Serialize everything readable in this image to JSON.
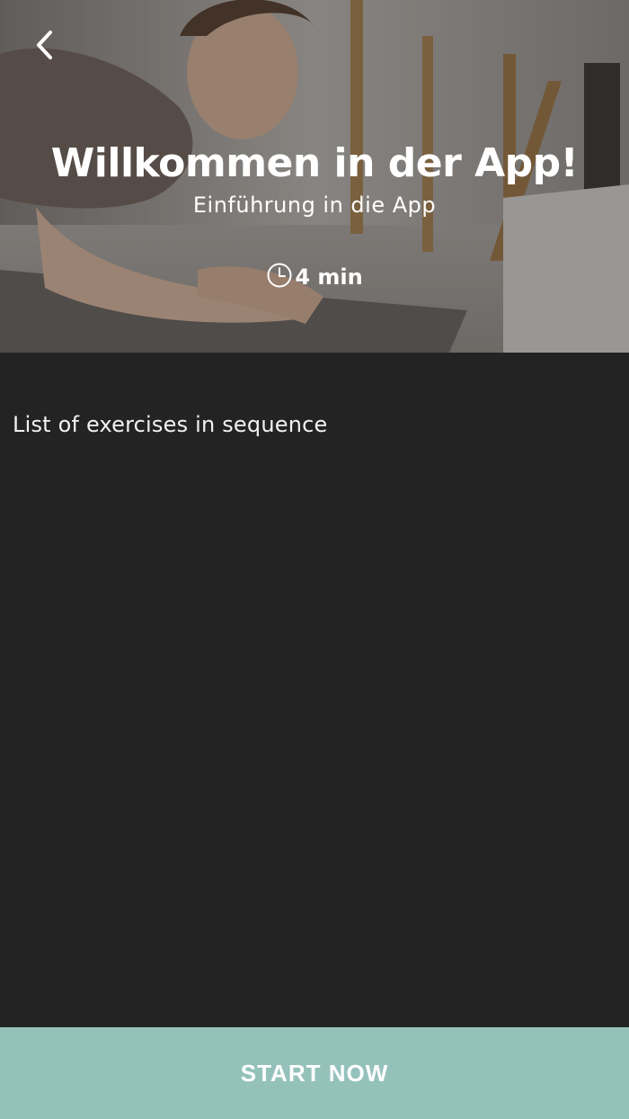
{
  "header": {
    "back_icon": "chevron-left-icon",
    "title": "Willkommen in der App!",
    "subtitle": "Einführung in die App",
    "duration_icon": "clock-icon",
    "duration": "4 min"
  },
  "main": {
    "list_heading": "List of exercises in sequence",
    "exercises": []
  },
  "footer": {
    "start_label": "START NOW"
  },
  "colors": {
    "background": "#232323",
    "accent": "#94c2bb",
    "text": "#ffffff"
  }
}
